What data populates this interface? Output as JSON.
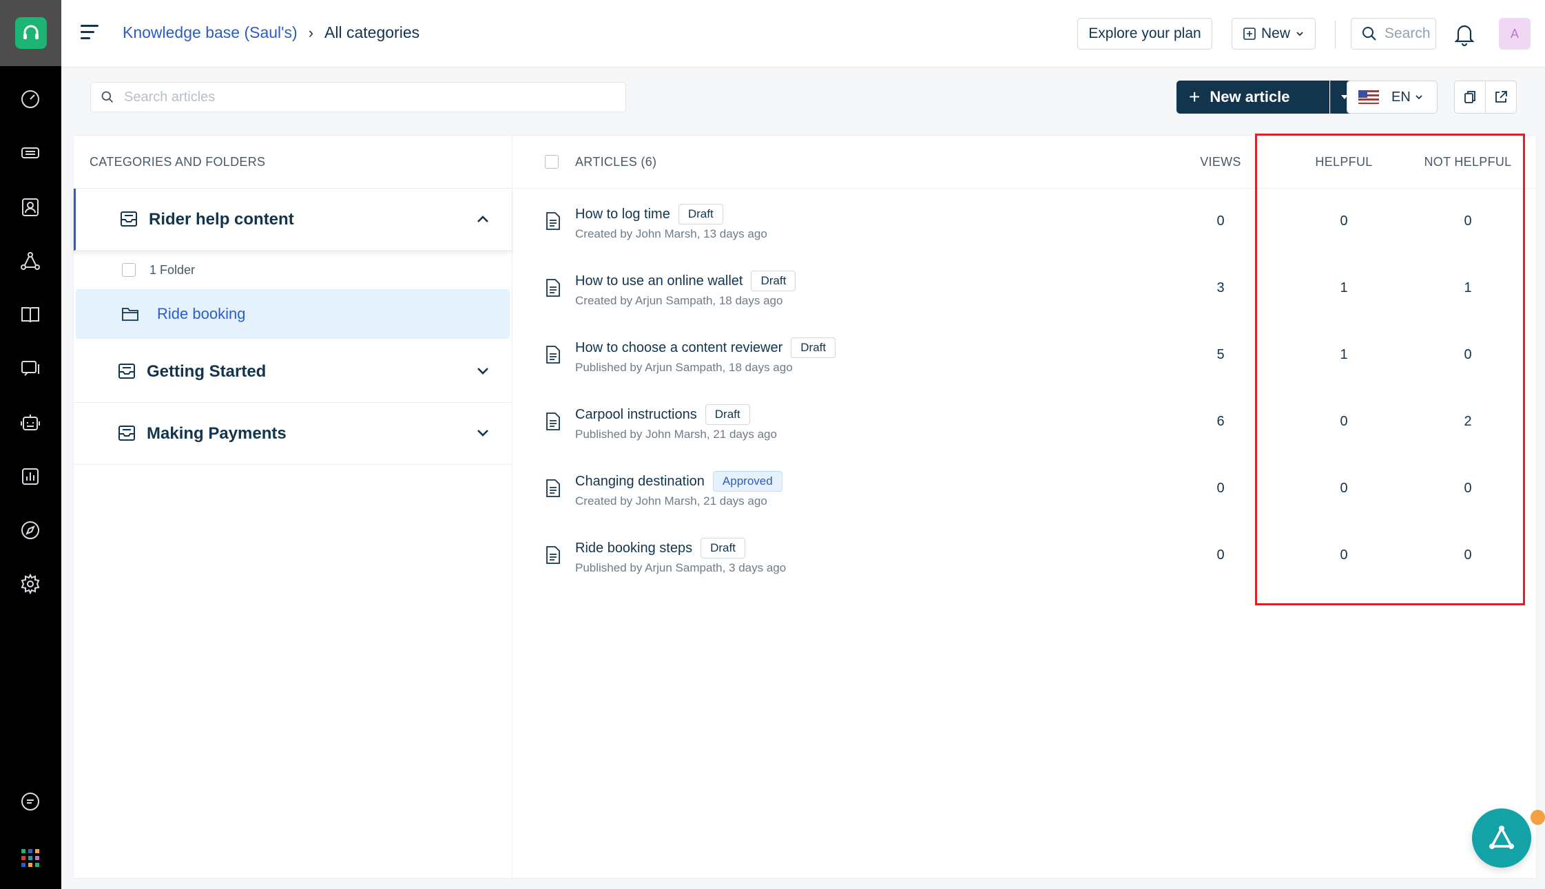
{
  "header": {
    "breadcrumb_link": "Knowledge base (Saul's)",
    "breadcrumb_current": "All categories",
    "explore_label": "Explore your plan",
    "new_label": "New",
    "search_label": "Search",
    "avatar_initial": "A"
  },
  "toolbar": {
    "search_placeholder": "Search articles",
    "new_article_label": "New article",
    "language": "EN"
  },
  "categories": {
    "header": "CATEGORIES AND FOLDERS",
    "items": [
      {
        "label": "Rider help content",
        "expanded": true
      },
      {
        "label": "Getting Started",
        "expanded": false
      },
      {
        "label": "Making Payments",
        "expanded": false
      }
    ],
    "folder_count": "1 Folder",
    "folders": [
      {
        "label": "Ride booking"
      }
    ]
  },
  "articles": {
    "header": "ARTICLES (6)",
    "col_views": "VIEWS",
    "col_helpful": "HELPFUL",
    "col_not_helpful": "NOT HELPFUL",
    "rows": [
      {
        "title": "How to log time",
        "status": "Draft",
        "meta": "Created by John Marsh, 13 days ago",
        "views": "0",
        "helpful": "0",
        "not_helpful": "0"
      },
      {
        "title": "How to use an online wallet",
        "status": "Draft",
        "meta": "Created by Arjun Sampath, 18 days ago",
        "views": "3",
        "helpful": "1",
        "not_helpful": "1"
      },
      {
        "title": "How to choose a content reviewer",
        "status": "Draft",
        "meta": "Published by Arjun Sampath, 18 days ago",
        "views": "5",
        "helpful": "1",
        "not_helpful": "0"
      },
      {
        "title": "Carpool instructions",
        "status": "Draft",
        "meta": "Published by John Marsh, 21 days ago",
        "views": "6",
        "helpful": "0",
        "not_helpful": "2"
      },
      {
        "title": "Changing destination",
        "status": "Approved",
        "meta": "Created by John Marsh, 21 days ago",
        "views": "0",
        "helpful": "0",
        "not_helpful": "0"
      },
      {
        "title": "Ride booking steps",
        "status": "Draft",
        "meta": "Published by Arjun Sampath, 3 days ago",
        "views": "0",
        "helpful": "0",
        "not_helpful": "0"
      }
    ]
  },
  "colors": {
    "brand": "#1db474",
    "primary": "#12344d",
    "link": "#2c5cc5",
    "highlight": "#d8232a",
    "fab": "#13a3a7"
  },
  "icons": {
    "rail": [
      "dashboard-icon",
      "tickets-icon",
      "contacts-icon",
      "network-icon",
      "book-icon",
      "chat-icon",
      "robot-icon",
      "reports-icon",
      "compass-icon",
      "settings-icon",
      "feedback-icon",
      "apps-grid-icon"
    ]
  }
}
